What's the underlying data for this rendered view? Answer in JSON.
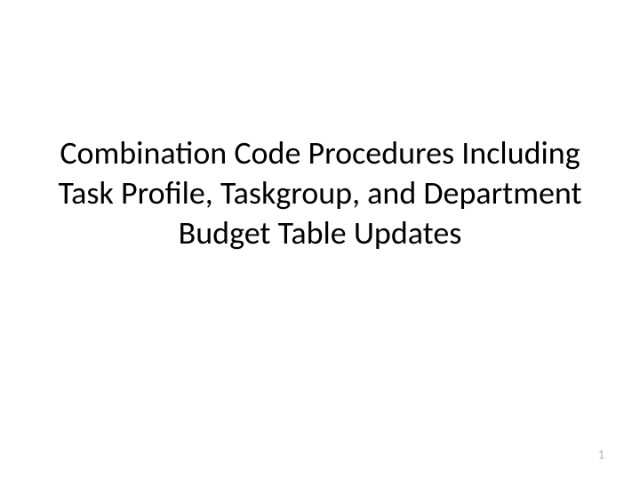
{
  "slide": {
    "title": "Combination Code Procedures Including Task Profile, Taskgroup, and Department Budget Table Updates",
    "page_number": "1"
  }
}
